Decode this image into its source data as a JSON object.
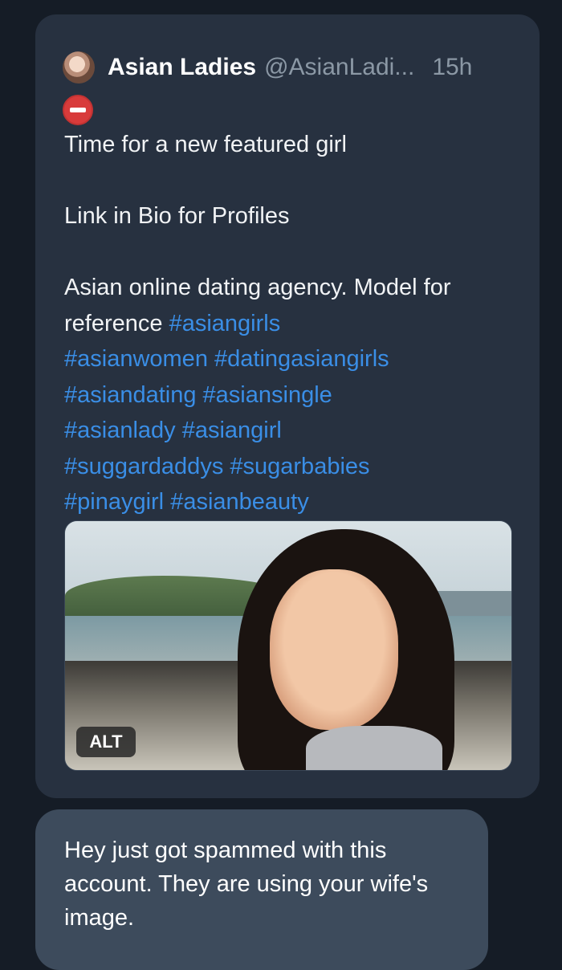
{
  "tweet": {
    "display_name": "Asian Ladies",
    "handle": "@AsianLadi...",
    "timestamp": "15h",
    "status_icon": "no-entry-icon",
    "text": {
      "line1": "Time for a new featured girl",
      "line2": "Link in Bio for Profiles",
      "line3_prefix": "Asian online dating agency. Model for reference ",
      "hashtags": [
        "#asiangirls",
        "#asianwomen",
        "#datingasiangirls",
        "#asiandating",
        "#asiansingle",
        "#asianlady",
        "#asiangirl",
        "#suggardaddys",
        "#sugarbabies",
        "#pinaygirl",
        "#asianbeauty"
      ]
    },
    "media": {
      "alt_label": "ALT"
    }
  },
  "reply": {
    "text": "Hey just got spammed with this account. They are using your wife's image."
  },
  "colors": {
    "background": "#151c26",
    "card": "#273140",
    "reply_bubble": "#3d4b5c",
    "hashtag": "#3a8ee6",
    "muted": "#8b98a5"
  }
}
